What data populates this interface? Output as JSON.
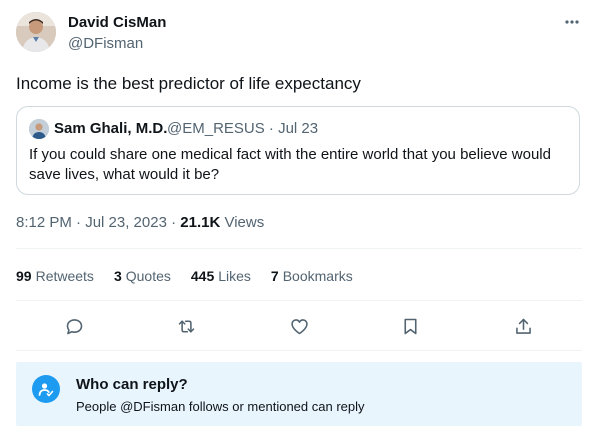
{
  "tweet": {
    "author_name": "David CisMan",
    "author_handle": "@DFisman",
    "text": "Income is the best predictor of life expectancy",
    "more_icon": "more-horizontal-icon"
  },
  "quoted": {
    "author_name": "Sam Ghali, M.D.",
    "author_handle_date": "@EM_RESUS · Jul 23",
    "text": "If you could share one medical fact with the entire world that you believe would save lives, what would it be?"
  },
  "meta": {
    "time_date": "8:12 PM · Jul 23, 2023 · ",
    "views_count": "21.1K",
    "views_label": " Views"
  },
  "stats": [
    {
      "num": "99",
      "label": "Retweets"
    },
    {
      "num": "3",
      "label": "Quotes"
    },
    {
      "num": "445",
      "label": "Likes"
    },
    {
      "num": "7",
      "label": "Bookmarks"
    }
  ],
  "actions": [
    "reply-icon",
    "retweet-icon",
    "like-icon",
    "bookmark-icon",
    "share-icon"
  ],
  "reply_settings": {
    "title": "Who can reply?",
    "subtitle": "People @DFisman follows or mentioned can reply",
    "accent": "#1d9bf0",
    "background": "#e8f5fd"
  }
}
